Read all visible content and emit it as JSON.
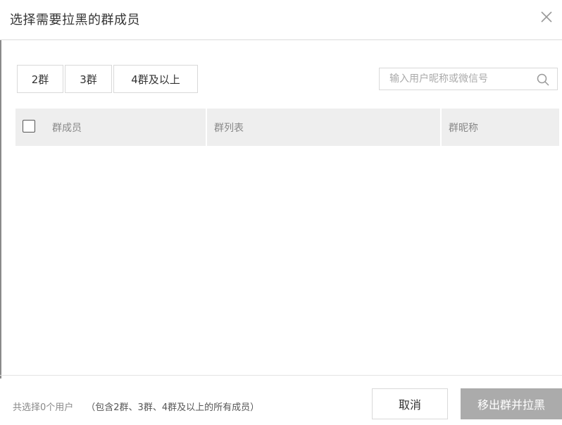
{
  "dialog": {
    "title": "选择需要拉黑的群成员"
  },
  "filters": {
    "items": [
      {
        "label": "2群"
      },
      {
        "label": "3群"
      },
      {
        "label": "4群及以上"
      }
    ]
  },
  "search": {
    "placeholder": "输入用户昵称或微信号"
  },
  "table": {
    "columns": [
      "群成员",
      "群列表",
      "群昵称"
    ],
    "rows": []
  },
  "footer": {
    "summary": "共选择0个用户",
    "note": "（包含2群、3群、4群及以上的所有成员）",
    "cancel_label": "取消",
    "confirm_label": "移出群并拉黑"
  },
  "icons": {
    "close": "close-icon",
    "search": "search-icon"
  },
  "colors": {
    "header_bg": "#eeeeee",
    "confirm_bg": "#ababab"
  }
}
